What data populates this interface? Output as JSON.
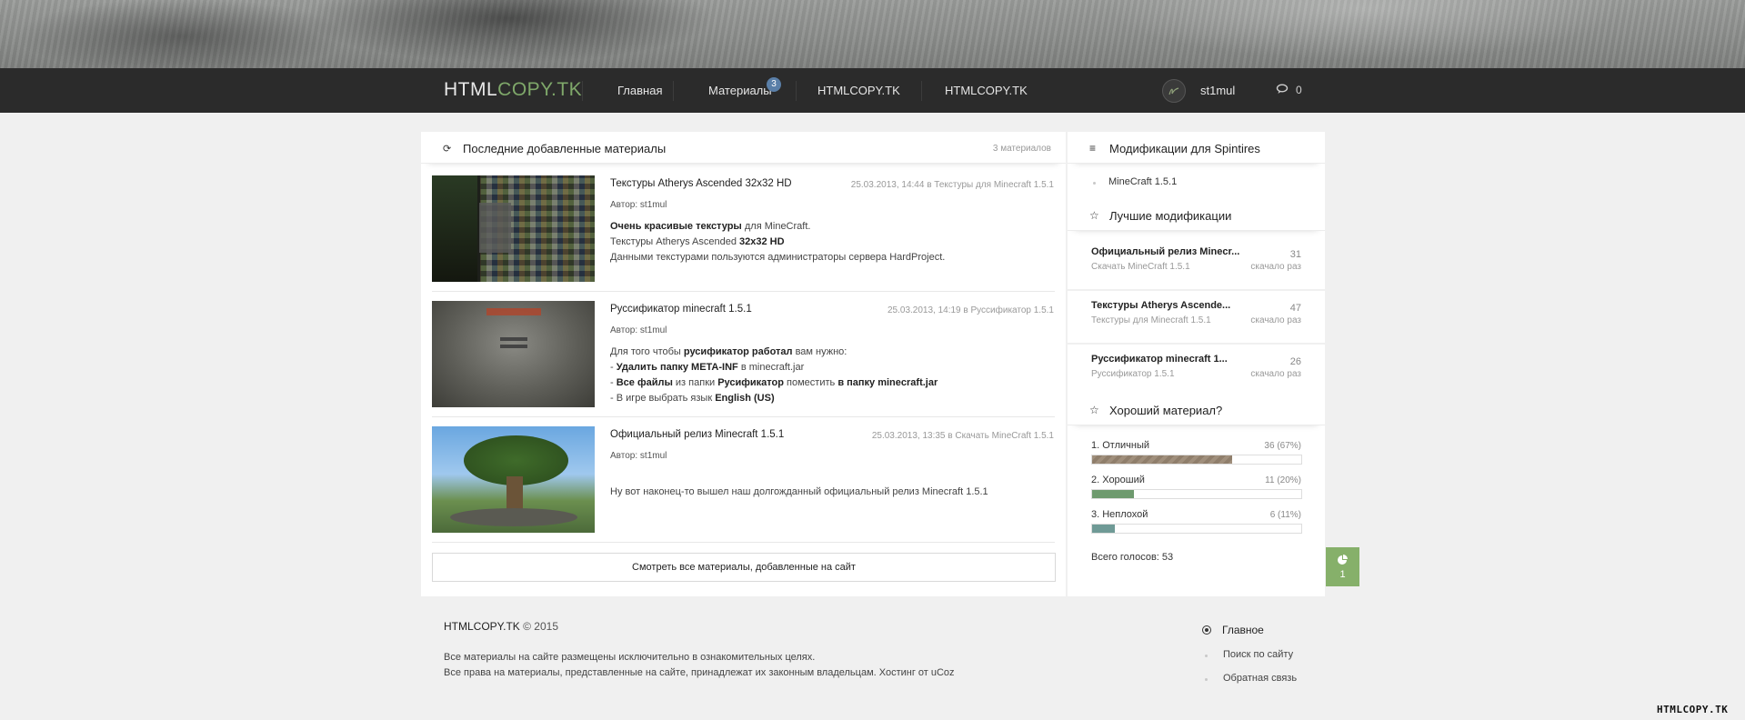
{
  "header": {
    "logo_main": "HTMLCOPY.TK",
    "logo_part1": "HTML",
    "logo_part2": "COPY.TK",
    "nav": [
      {
        "label": "Главная"
      },
      {
        "label": "Материалы",
        "badge": "3"
      },
      {
        "label": "HTMLCOPY.TK"
      },
      {
        "label": "HTMLCOPY.TK"
      }
    ],
    "username": "st1mul",
    "messages_count": "0"
  },
  "main": {
    "title": "Последние добавленные материалы",
    "count": "3 материалов",
    "items": [
      {
        "title": "Текстуры Atherys Ascended 32x32 HD",
        "meta": "25.03.2013, 14:44 в Текстуры для Minecraft 1.5.1",
        "author": "Автор: st1mul",
        "body": [
          {
            "bold": "Очень красивые текстуры",
            "text": " для MineCraft."
          },
          {
            "text": "Текстуры Atherys Ascended ",
            "bold": "32x32 HD"
          },
          {
            "text": "Данными текстурами пользуются администраторы сервера HardProject."
          }
        ]
      },
      {
        "title": "Руссификатор minecraft 1.5.1",
        "meta": "25.03.2013, 14:19 в Руссификатор 1.5.1",
        "author": "Автор: st1mul",
        "body_l1a": "Для того чтобы ",
        "body_l1b": "русификатор работал",
        "body_l1c": " вам нужно:",
        "body_l2a": "- ",
        "body_l2b": "Удалить папку META-INF",
        "body_l2c": " в minecraft.jar",
        "body_l3a": "- ",
        "body_l3b": "Все файлы",
        "body_l3c": " из папки ",
        "body_l3d": "Русификатор",
        "body_l3e": " поместить ",
        "body_l3f": "в папку minecraft.jar",
        "body_l4a": "- В игре выбрать язык ",
        "body_l4b": "English (US)"
      },
      {
        "title": "Официальный релиз Minecraft 1.5.1",
        "meta": "25.03.2013, 13:35 в Скачать MineCraft 1.5.1",
        "author": "Автор: st1mul",
        "body": "Ну вот наконец-то вышел наш долгожданный официальный релиз Minecraft 1.5.1"
      }
    ],
    "view_all": "Смотреть все материалы, добавленные на сайт"
  },
  "sidebar": {
    "mods_title": "Модификации для Spintires",
    "mods_links": [
      "MineCraft 1.5.1"
    ],
    "best_title": "Лучшие модификации",
    "best_items": [
      {
        "title": "Официальный релиз Minecr...",
        "category": "Скачать MineCraft 1.5.1",
        "count": "31",
        "unit": "скачало раз"
      },
      {
        "title": "Текстуры Atherys Ascende...",
        "category": "Текстуры для Minecraft 1.5.1",
        "count": "47",
        "unit": "скачало раз"
      },
      {
        "title": "Руссификатор minecraft 1...",
        "category": "Руссификатор 1.5.1",
        "count": "26",
        "unit": "скачало раз"
      }
    ],
    "poll_title": "Хороший материал?",
    "poll": [
      {
        "label": "1. Отличный",
        "value": "36 (67%)",
        "percent": 67
      },
      {
        "label": "2. Хороший",
        "value": "11 (20%)",
        "percent": 20
      },
      {
        "label": "3. Неплохой",
        "value": "6 (11%)",
        "percent": 11
      }
    ],
    "poll_total": "Всего голосов: 53"
  },
  "float_badge": {
    "count": "1"
  },
  "footer": {
    "brand": "HTMLCOPY.TK",
    "brand_suffix": " © 2015",
    "note1": "Все материалы на сайте размещены исключительно в ознакомительных целях.",
    "note2": "Все права на материалы, представленные на сайте, принадлежат их законным владельцам. Хостинг от uCoz",
    "menu_title": "Главное",
    "menu_links": [
      "Поиск по сайту",
      "Обратная связь"
    ]
  },
  "watermark": "HTMLCOPY.TK",
  "colors": {
    "accent": "#7fa86a",
    "navbar": "#2b2b2b",
    "badge": "#5a7fa8",
    "float": "#86b06a"
  }
}
